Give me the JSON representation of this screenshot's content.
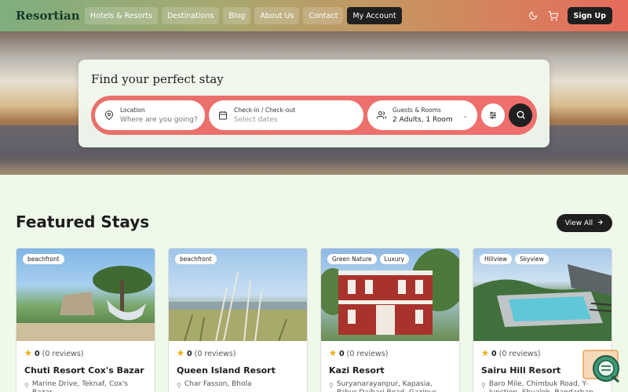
{
  "brand": "Resortian",
  "nav": [
    "Hotels & Resorts",
    "Destinations",
    "Blog",
    "About Us",
    "Contact",
    "My Account"
  ],
  "header": {
    "signup": "Sign Up"
  },
  "search": {
    "title": "Find your perfect stay",
    "location_label": "Location",
    "location_placeholder": "Where are you going?",
    "dates_label": "Check-in / Check-out",
    "dates_placeholder": "Select dates",
    "guests_label": "Guests & Rooms",
    "guests_value": "2 Adults, 1 Room"
  },
  "featured": {
    "title": "Featured Stays",
    "view_all": "View All",
    "cards": [
      {
        "tags": [
          "beachfront"
        ],
        "rating": "0",
        "reviews": "(0 reviews)",
        "name": "Chuti Resort Cox's Bazar",
        "location": "Marine Drive, Teknaf, Cox's Bazar"
      },
      {
        "tags": [
          "beachfront"
        ],
        "rating": "0",
        "reviews": "(0 reviews)",
        "name": "Queen Island Resort",
        "location": "Char Fasson, Bhola"
      },
      {
        "tags": [
          "Green Nature",
          "Luxury"
        ],
        "rating": "0",
        "reviews": "(0 reviews)",
        "name": "Kazi Resort",
        "location": "Suryanarayanpur, Kapasia, Pabur Daihari Road, Gazipur"
      },
      {
        "tags": [
          "Hillview",
          "Skyview"
        ],
        "rating": "0",
        "reviews": "(0 reviews)",
        "name": "Sairu Hill Resort",
        "location": "Baro Mile, Chimbuk Road, Y-Junction, Shualok, Bandarban"
      }
    ]
  },
  "colors": {
    "accent": "#e9706a",
    "dark": "#1f1f1f",
    "star": "#f2b01e"
  },
  "icons": [
    "moon-icon",
    "cart-icon",
    "map-pin-icon",
    "calendar-icon",
    "users-icon",
    "sliders-icon",
    "search-icon",
    "arrow-right-icon",
    "star-icon",
    "chat-icon"
  ]
}
